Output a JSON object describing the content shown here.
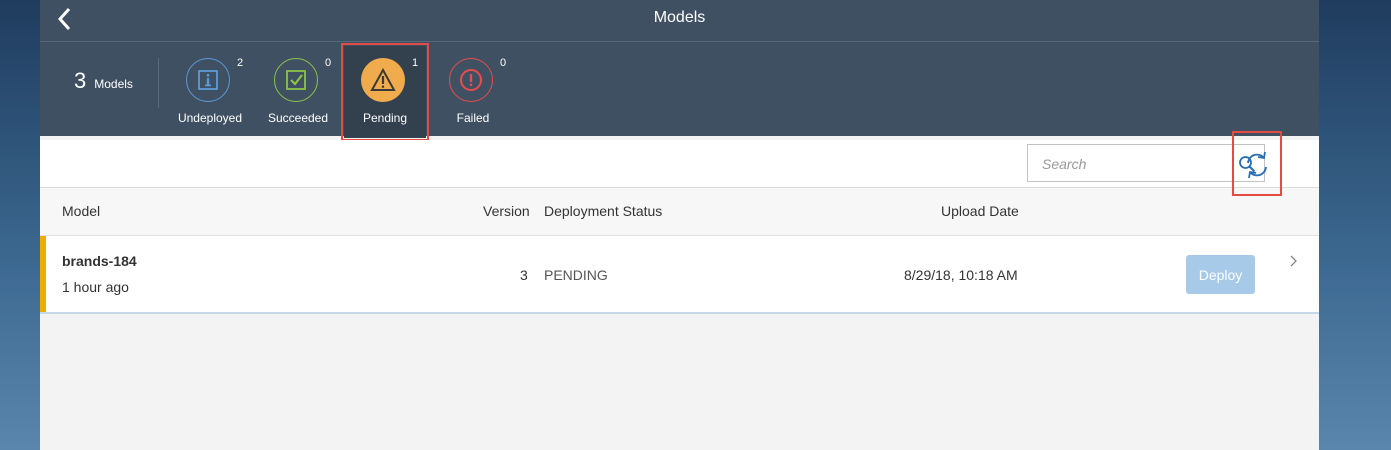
{
  "header": {
    "title": "Models"
  },
  "summary": {
    "count": "3",
    "count_label": "Models",
    "filters": [
      {
        "label": "Undeployed",
        "count": "2",
        "color": "#5b9bd5",
        "icon": "info-icon"
      },
      {
        "label": "Succeeded",
        "count": "0",
        "color": "#8bc34a",
        "icon": "checkbox-icon"
      },
      {
        "label": "Pending",
        "count": "1",
        "color": "#f0ab4c",
        "icon": "warning-icon",
        "selected": true
      },
      {
        "label": "Failed",
        "count": "0",
        "color": "#e84c4c",
        "icon": "error-icon"
      }
    ]
  },
  "toolbar": {
    "search_placeholder": "Search",
    "refresh_icon": "refresh-icon"
  },
  "table": {
    "columns": [
      "Model",
      "Version",
      "Deployment Status",
      "Upload Date"
    ],
    "rows": [
      {
        "model": "brands-184",
        "age": "1 hour ago",
        "version": "3",
        "status": "PENDING",
        "upload_date": "8/29/18, 10:18 AM",
        "action": "Deploy",
        "status_color": "#f0ab00"
      }
    ]
  },
  "colors": {
    "shell": "#3f5062",
    "highlight": "#e34b43",
    "deploy_button": "#a8cae9"
  }
}
